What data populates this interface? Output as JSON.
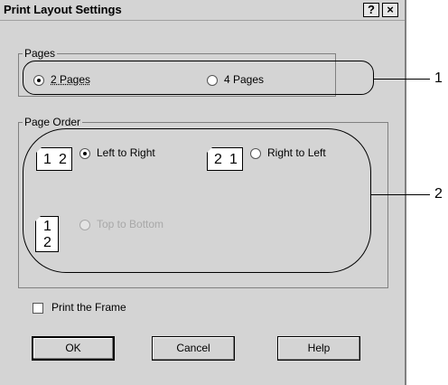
{
  "window": {
    "title": "Print Layout Settings",
    "help_glyph": "?",
    "close_glyph": "×"
  },
  "pages_group": {
    "label": "Pages",
    "options": [
      {
        "label": "2 Pages",
        "selected": true
      },
      {
        "label": "4 Pages",
        "selected": false
      }
    ]
  },
  "order_group": {
    "label": "Page Order",
    "options": [
      {
        "label": "Left to Right",
        "selected": true,
        "enabled": true,
        "icon_pages": [
          "1",
          "2"
        ]
      },
      {
        "label": "Right to Left",
        "selected": false,
        "enabled": true,
        "icon_pages": [
          "2",
          "1"
        ]
      },
      {
        "label": "Top to Bottom",
        "selected": false,
        "enabled": false,
        "icon_pages": [
          "1",
          "2"
        ]
      }
    ]
  },
  "print_frame": {
    "label": "Print the Frame",
    "checked": false
  },
  "buttons": {
    "ok": "OK",
    "cancel": "Cancel",
    "help": "Help"
  },
  "callouts": [
    "1",
    "2"
  ],
  "icons": {
    "help": "question-mark",
    "close": "x",
    "page_order_icon": "page-layout-diagram"
  }
}
